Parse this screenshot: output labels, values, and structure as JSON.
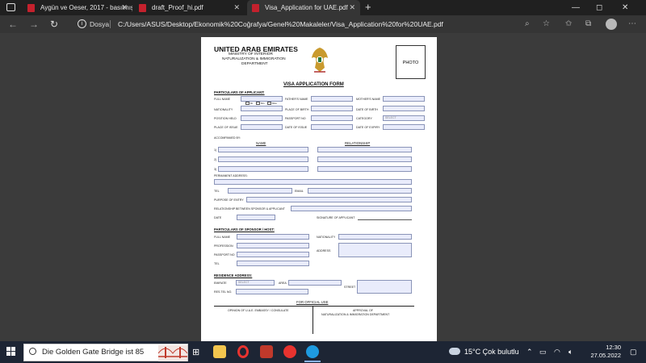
{
  "tabs": [
    {
      "title": "Aygün ve Oeser, 2017 - basılmış.pdf",
      "active": false
    },
    {
      "title": "draft_Proof_hi.pdf",
      "active": false
    },
    {
      "title": "Visa_Application for UAE.pdf",
      "active": true
    }
  ],
  "window_controls": {
    "minimize": "—",
    "maximize": "◻",
    "close": "✕"
  },
  "address": {
    "label": "Dosya",
    "url": "C:/Users/ASUS/Desktop/Ekonomik%20Coğrafya/Genel%20Makaleler/Visa_Application%20for%20UAE.pdf"
  },
  "doc": {
    "country": "UNITED ARAB EMIRATES",
    "ministry": [
      "MINISTRY OF INTERIOR",
      "NATURALIZATION & IMMIGRATION",
      "DEPARTMENT"
    ],
    "photo": "PHOTO",
    "form_title": "VISA APPLICATION FORM",
    "particulars_applicant": "PARTICULARS OF APPLICANT:",
    "labels": {
      "full_name": "FULL NAME",
      "fathers_name": "FATHER'S NAME",
      "mothers_name": "MOTHER'S NAME",
      "nationality": "NATIONALITY",
      "place_of_birth": "PLACE OF BIRTH",
      "date_of_birth": "DATE OF BIRTH",
      "position_held": "POSITION HELD",
      "passport_no": "PASSPORT NO",
      "category": "CATEGORY",
      "place_of_issue": "PLACE OF ISSUE",
      "date_of_issue": "DATE OF ISSUE",
      "date_of_expiry": "DATE OF EXPIRY",
      "accompanied_by": "ACCOMPANIED BY:",
      "name": "NAME",
      "relationship": "RELATIONSHIP",
      "row1": "1)",
      "row2": "2)",
      "row3": "3)",
      "permanent_address": "PERMANENT ADDRESS:",
      "tel": "TEL",
      "email": "EMAIL",
      "purpose": "PURPOSE OF ENTRY",
      "relationship_sponsor": "RELATIONSHIP BETWEEN SPONSOR & APPLICANT",
      "date": "DATE",
      "signature": "SIGNATURE OF APPLICANT",
      "particulars_sponsor": "PARTICULARS OF SPONSOR / HOST:",
      "s_full_name": "FULL NAME",
      "s_nationality": "NATIONALITY",
      "s_profession": "PROFESSION",
      "s_address": "ADDRESS",
      "s_passport": "PASSPORT NO",
      "s_tel": "TEL",
      "residence_address": "RESIDENCE ADDRESS:",
      "emirate": "EMIRATE",
      "area": "AREA",
      "street": "STREET",
      "res_tel": "RES.TEL NO.",
      "official_use": "FOR OFFICIAL USE",
      "opinion": "OPINION OF U.A.E. EMBASSY / CONSULATE",
      "approval": [
        "APPROVAL OF",
        "NATURALIZATION & IMMIGRATION DEPARTMENT"
      ]
    },
    "select_placeholder": "SELECT",
    "nationality_options": [
      "Mr",
      "Mrs",
      "Miss"
    ]
  },
  "taskbar": {
    "search_text": "Die Golden Gate Bridge ist 85",
    "weather": "15°C  Çok bulutlu",
    "time": "12:30",
    "date": "27.05.2022"
  },
  "colors": {
    "tabbar": "#202020",
    "navbar": "#353535",
    "viewer": "#3b3b3b",
    "field": "#e9ecfb",
    "taskbar": "#1d2534"
  }
}
